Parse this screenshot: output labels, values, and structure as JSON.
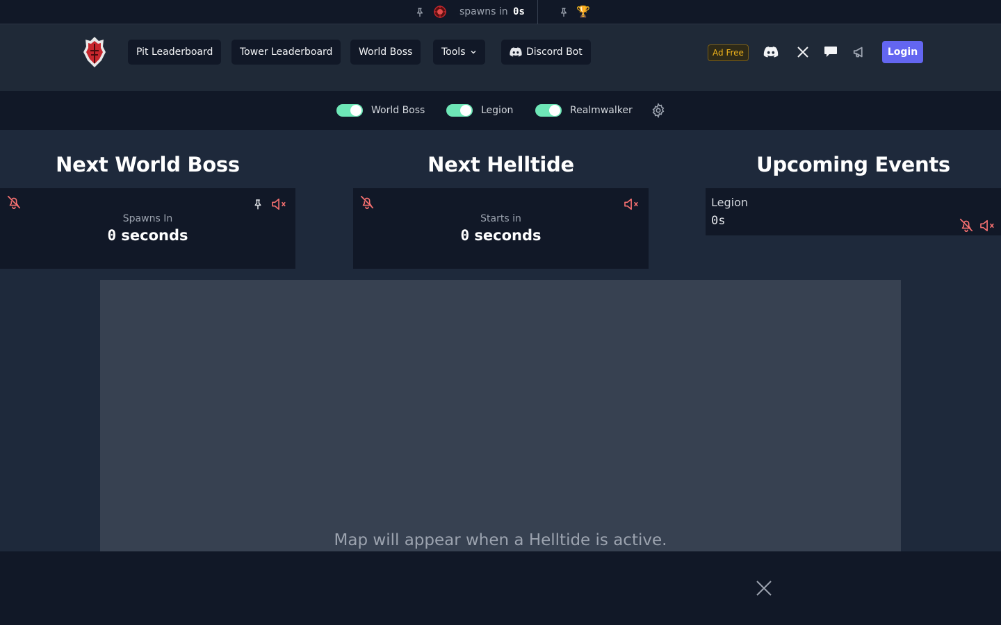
{
  "ticker": {
    "spawns_label": "spawns in",
    "spawns_value": "0s"
  },
  "nav": {
    "pit_leaderboard": "Pit Leaderboard",
    "tower_leaderboard": "Tower Leaderboard",
    "world_boss": "World Boss",
    "tools": "Tools",
    "discord_bot": "Discord Bot",
    "ad_free": "Ad Free",
    "login": "Login"
  },
  "toggles": [
    {
      "label": "World Boss",
      "on": true
    },
    {
      "label": "Legion",
      "on": true
    },
    {
      "label": "Realmwalker",
      "on": true
    }
  ],
  "sections": {
    "world_boss": {
      "title": "Next World Boss",
      "caption": "Spawns In",
      "value_num": "0",
      "value_unit": "seconds"
    },
    "helltide": {
      "title": "Next Helltide",
      "caption": "Starts in",
      "value_num": "0",
      "value_unit": "seconds"
    },
    "events": {
      "title": "Upcoming Events",
      "items": [
        {
          "name": "Legion",
          "time": "0s"
        }
      ]
    }
  },
  "map": {
    "message": "Map will appear when a Helltide is active."
  },
  "colors": {
    "accent": "#6366f1",
    "toggle_on": "#6ee7b7",
    "alert_red": "#f87171",
    "gold": "#f2b51c"
  },
  "icons": [
    "pin-icon",
    "boss-icon",
    "trophy-icon",
    "discord-icon",
    "x-icon",
    "chat-icon",
    "megaphone-icon",
    "gear-icon",
    "bell-off-icon",
    "mute-icon",
    "close-icon"
  ]
}
